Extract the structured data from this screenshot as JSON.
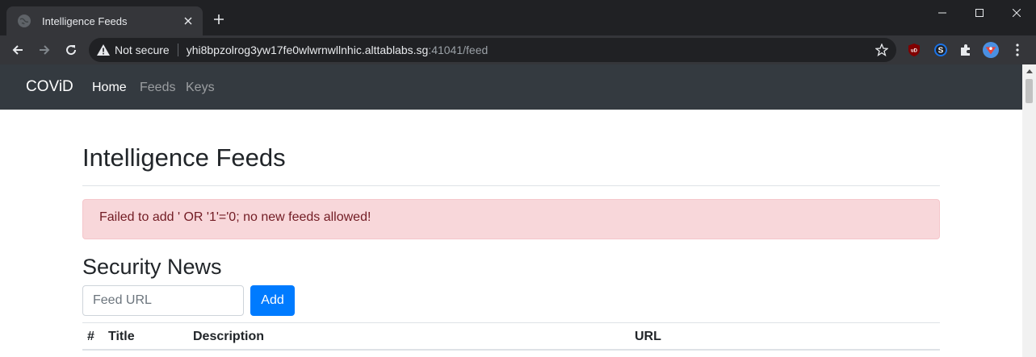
{
  "browser": {
    "tab_title": "Intelligence Feeds",
    "url_host": "yhi8bpzolrog3yw17fe0wlwrnwllnhic.alttablabs.sg",
    "url_path": ":41041/feed",
    "security_label": "Not secure"
  },
  "navbar": {
    "brand": "COViD",
    "links": [
      {
        "label": "Home",
        "active": true
      },
      {
        "label": "Feeds",
        "active": false
      },
      {
        "label": "Keys",
        "active": false
      }
    ]
  },
  "page": {
    "title": "Intelligence Feeds",
    "alert": "Failed to add ' OR '1'='0; no new feeds allowed!",
    "section_title": "Security News",
    "feed_input": {
      "placeholder": "Feed URL",
      "value": ""
    },
    "add_button": "Add",
    "table": {
      "columns": [
        "#",
        "Title",
        "Description",
        "URL"
      ],
      "rows": []
    }
  },
  "colors": {
    "navbar_bg": "#343a40",
    "alert_bg": "#f8d7da",
    "alert_text": "#721c24",
    "primary": "#007bff"
  }
}
